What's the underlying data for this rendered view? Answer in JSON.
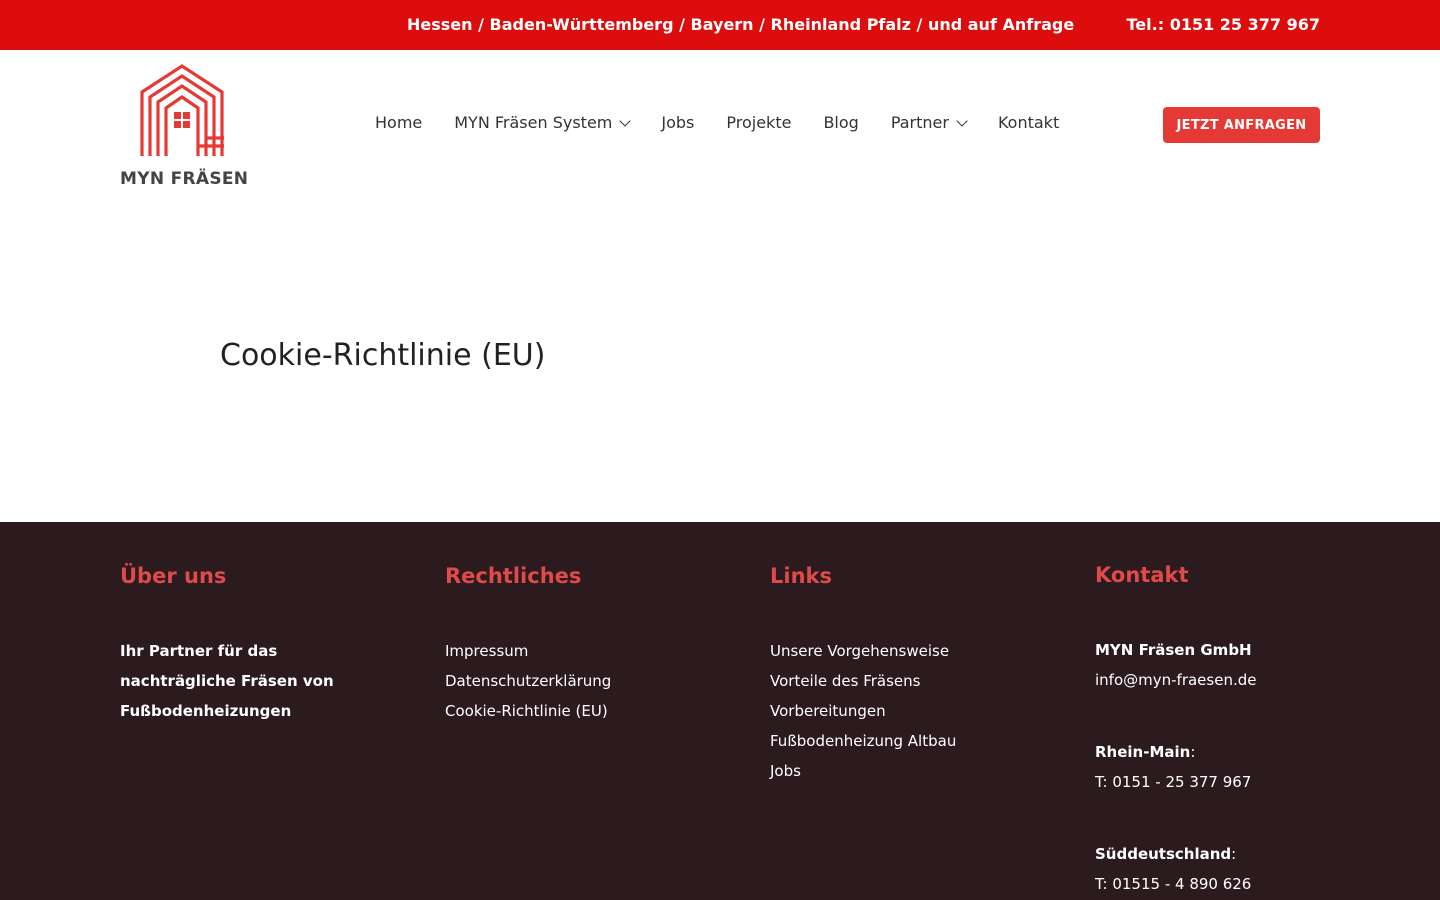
{
  "topbar": {
    "regions": "Hessen / Baden-Württemberg / Bayern / Rheinland Pfalz / und auf Anfrage",
    "phone": "Tel.: 0151 25 377 967"
  },
  "brand": {
    "name": "MYN FRÄSEN",
    "logo_icon": "house-logo-icon",
    "accent": "#e53935",
    "topbar_color": "#dd0d0d"
  },
  "nav": {
    "items": [
      {
        "label": "Home"
      },
      {
        "label": "MYN Fräsen System"
      },
      {
        "label": "Jobs"
      },
      {
        "label": "Projekte"
      },
      {
        "label": "Blog"
      },
      {
        "label": "Partner"
      },
      {
        "label": "Kontakt"
      }
    ],
    "cta": "JETZT ANFRAGEN"
  },
  "main": {
    "title": "Cookie-Richtlinie (EU)"
  },
  "footer": {
    "background": "#2b1a1e",
    "about": {
      "heading": "Über uns",
      "line1": "Ihr Partner für das",
      "line2": "nachträgliche Fräsen von",
      "line3": "Fußbodenheizungen"
    },
    "legal": {
      "heading": "Rechtliches",
      "links": [
        "Impressum",
        "Datenschutzerklärung",
        "Cookie-Richtlinie (EU)"
      ]
    },
    "links": {
      "heading": "Links",
      "items": [
        "Unsere Vorgehensweise",
        "Vorteile des Fräsens",
        "Vorbereitungen",
        "Fußbodenheizung Altbau",
        "Jobs"
      ]
    },
    "contact": {
      "heading": "Kontakt",
      "company": "MYN Fräsen GmbH",
      "email": "info@myn-fraesen.de",
      "region1": "Rhein-Main",
      "phone1": "T: 0151 - 25 377 967",
      "region2": "Süddeutschland",
      "phone2": "T: 01515 - 4 890 626",
      "colon": ":"
    }
  }
}
